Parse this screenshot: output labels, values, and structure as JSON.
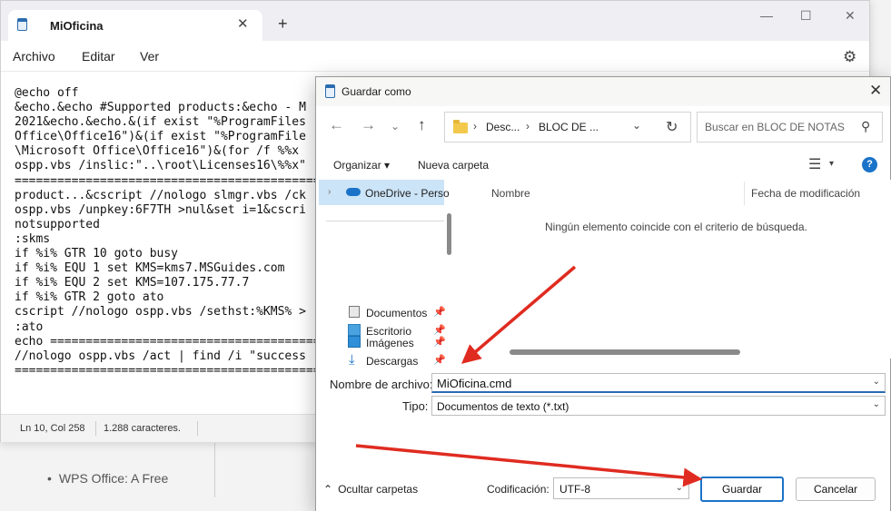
{
  "background": {
    "bullet_text": "WPS Office: A Free"
  },
  "notepad": {
    "tab_title": "MiOficina",
    "menu": [
      "Archivo",
      "Editar",
      "Ver"
    ],
    "text_lines": [
      "@echo off",
      "&echo.&echo #Supported products:&echo - M",
      "2021&echo.&echo.&(if exist \"%ProgramFiles",
      "Office\\Office16\")&(if exist \"%ProgramFile",
      "\\Microsoft Office\\Office16\")&(for /f %%x",
      "ospp.vbs /inslic:\"..\\root\\Licenses16\\%%x\"",
      "=============================================",
      "product...&cscript //nologo slmgr.vbs /ck",
      "ospp.vbs /unpkey:6F7TH >nul&set i=1&cscri",
      "notsupported",
      ":skms",
      "if %i% GTR 10 goto busy",
      "if %i% EQU 1 set KMS=kms7.MSGuides.com",
      "if %i% EQU 2 set KMS=107.175.77.7",
      "if %i% GTR 2 goto ato",
      "cscript //nologo ospp.vbs /sethst:%KMS% >",
      ":ato",
      "echo ========================================",
      "//nologo ospp.vbs /act | find /i \"success",
      "============================================="
    ],
    "status_position": "Ln 10, Col 258",
    "status_chars": "1.288 caracteres."
  },
  "dialog": {
    "title": "Guardar como",
    "address": {
      "crumb1": "Desc...",
      "crumb2": "BLOC DE ..."
    },
    "search_placeholder": "Buscar en BLOC DE NOTAS",
    "toolbar": {
      "organize": "Organizar",
      "new_folder": "Nueva carpeta"
    },
    "nav_items": {
      "onedrive": "OneDrive - Perso",
      "desktop": "Escritorio",
      "downloads": "Descargas",
      "documents": "Documentos",
      "images": "Imágenes"
    },
    "columns": {
      "name": "Nombre",
      "modified": "Fecha de modificación"
    },
    "empty_message": "Ningún elemento coincide con el criterio de búsqueda.",
    "filename_label": "Nombre de archivo:",
    "filename_value": "MiOficina.cmd",
    "type_label": "Tipo:",
    "type_value": "Documentos de texto (*.txt)",
    "hide_folders": "Ocultar carpetas",
    "encoding_label": "Codificación:",
    "encoding_value": "UTF-8",
    "save_button": "Guardar",
    "cancel_button": "Cancelar"
  },
  "colors": {
    "accent": "#1a73c8",
    "arrow": "#e02b20"
  }
}
